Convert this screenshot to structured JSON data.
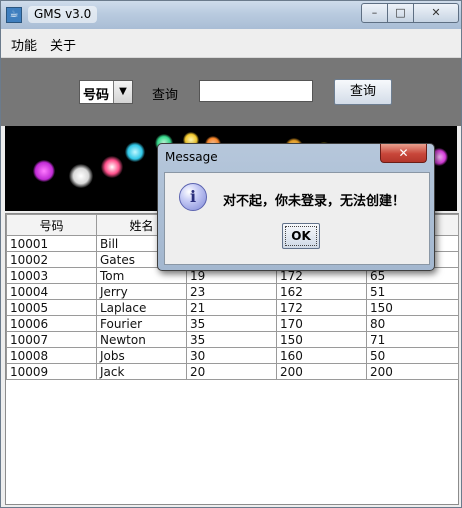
{
  "window": {
    "title": "GMS v3.0",
    "app_icon": "java-cup-icon"
  },
  "menu": {
    "items": [
      "功能",
      "关于"
    ]
  },
  "search": {
    "select_value": "号码",
    "label": "查询",
    "input_value": "",
    "button_label": "查询"
  },
  "table": {
    "headers": [
      "号码",
      "姓名",
      "",
      "",
      ""
    ],
    "rows": [
      [
        "10001",
        "Bill",
        "",
        "",
        ""
      ],
      [
        "10002",
        "Gates",
        "",
        "",
        ""
      ],
      [
        "10003",
        "Tom",
        "19",
        "172",
        "65"
      ],
      [
        "10004",
        "Jerry",
        "23",
        "162",
        "51"
      ],
      [
        "10005",
        "Laplace",
        "21",
        "172",
        "150"
      ],
      [
        "10006",
        "Fourier",
        "35",
        "170",
        "80"
      ],
      [
        "10007",
        "Newton",
        "35",
        "150",
        "71"
      ],
      [
        "10008",
        "Jobs",
        "30",
        "160",
        "50"
      ],
      [
        "10009",
        "Jack",
        "20",
        "200",
        "200"
      ]
    ]
  },
  "dialog": {
    "title": "Message",
    "message": "对不起，你未登录，无法创建！",
    "ok_label": "OK",
    "icon": "info-icon"
  },
  "colors": {
    "search_bar": "#777777",
    "dialog_frame": "#a3b7cf",
    "close_button": "#c8463a"
  }
}
